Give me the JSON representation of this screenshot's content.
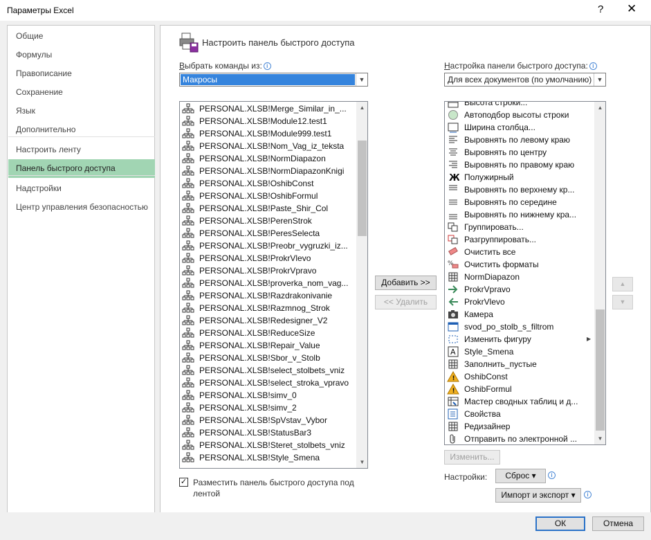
{
  "window": {
    "title": "Параметры Excel",
    "help": "?",
    "close": "✕"
  },
  "nav": {
    "items": [
      {
        "label": "Общие"
      },
      {
        "label": "Формулы"
      },
      {
        "label": "Правописание"
      },
      {
        "label": "Сохранение"
      },
      {
        "label": "Язык"
      },
      {
        "label": "Дополнительно"
      },
      {
        "label": "Настроить ленту"
      },
      {
        "label": "Панель быстрого доступа",
        "selected": true
      },
      {
        "label": "Надстройки"
      },
      {
        "label": "Центр управления безопасностью"
      }
    ]
  },
  "header": {
    "title": "Настроить панель быстрого доступа"
  },
  "left": {
    "label_underlined": "В",
    "label_rest": "ыбрать команды из:",
    "combo_value": "Макросы",
    "items": [
      "PERSONAL.XLSB!Merge_Similar_in_...",
      "PERSONAL.XLSB!Module12.test1",
      "PERSONAL.XLSB!Module999.test1",
      "PERSONAL.XLSB!Nom_Vag_iz_teksta",
      "PERSONAL.XLSB!NormDiapazon",
      "PERSONAL.XLSB!NormDiapazonKnigi",
      "PERSONAL.XLSB!OshibConst",
      "PERSONAL.XLSB!OshibFormul",
      "PERSONAL.XLSB!Paste_Shir_Col",
      "PERSONAL.XLSB!PerenStrok",
      "PERSONAL.XLSB!PeresSelecta",
      "PERSONAL.XLSB!Preobr_vygruzki_iz...",
      "PERSONAL.XLSB!ProkrVlevo",
      "PERSONAL.XLSB!ProkrVpravo",
      "PERSONAL.XLSB!proverka_nom_vag...",
      "PERSONAL.XLSB!Razdrakonivanie",
      "PERSONAL.XLSB!Razmnog_Strok",
      "PERSONAL.XLSB!Redesigner_V2",
      "PERSONAL.XLSB!ReduceSize",
      "PERSONAL.XLSB!Repair_Value",
      "PERSONAL.XLSB!Sbor_v_Stolb",
      "PERSONAL.XLSB!select_stolbets_vniz",
      "PERSONAL.XLSB!select_stroka_vpravo",
      "PERSONAL.XLSB!simv_0",
      "PERSONAL.XLSB!simv_2",
      "PERSONAL.XLSB!SpVstav_Vybor",
      "PERSONAL.XLSB!StatusBar3",
      "PERSONAL.XLSB!Steret_stolbets_vniz",
      "PERSONAL.XLSB!Style_Smena"
    ],
    "checkbox_line1": "Разместить панель быстрого доступа под",
    "checkbox_line2": "лентой"
  },
  "middle": {
    "add_button": "Добавить >>",
    "remove_button": "<< Удалить"
  },
  "right": {
    "label_underlined": "Н",
    "label_rest": "астройка панели быстрого доступа:",
    "combo_value": "Для всех документов (по умолчанию)",
    "items": [
      {
        "label": "Высота строки...",
        "icon": "row-height-icon"
      },
      {
        "label": "Автоподбор высоты строки",
        "icon": "autofit-icon"
      },
      {
        "label": "Ширина столбца...",
        "icon": "column-width-icon"
      },
      {
        "label": "Выровнять по левому краю",
        "icon": "align-left-icon"
      },
      {
        "label": "Выровнять по центру",
        "icon": "align-center-icon"
      },
      {
        "label": "Выровнять по правому краю",
        "icon": "align-right-icon"
      },
      {
        "label": "Полужирный",
        "icon": "bold-icon"
      },
      {
        "label": "Выровнять по верхнему кр...",
        "icon": "align-top-icon"
      },
      {
        "label": "Выровнять по середине",
        "icon": "align-middle-icon"
      },
      {
        "label": "Выровнять по нижнему кра...",
        "icon": "align-bottom-icon"
      },
      {
        "label": "Группировать...",
        "icon": "group-icon"
      },
      {
        "label": "Разгруппировать...",
        "icon": "ungroup-icon"
      },
      {
        "label": "Очистить все",
        "icon": "eraser-icon"
      },
      {
        "label": "Очистить форматы",
        "icon": "clear-formats-icon"
      },
      {
        "label": "NormDiapazon",
        "icon": "grid-icon"
      },
      {
        "label": "ProkrVpravo",
        "icon": "arrow-right-icon"
      },
      {
        "label": "ProkrVlevo",
        "icon": "arrow-left-icon"
      },
      {
        "label": "Камера",
        "icon": "camera-icon"
      },
      {
        "label": "svod_po_stolb_s_filtrom",
        "icon": "table-icon"
      },
      {
        "label": "Изменить фигуру",
        "icon": "edit-shape-icon"
      },
      {
        "label": "Style_Smena",
        "icon": "style-icon"
      },
      {
        "label": "Заполнить_пустые",
        "icon": "grid-icon"
      },
      {
        "label": "OshibConst",
        "icon": "warning-icon"
      },
      {
        "label": "OshibFormul",
        "icon": "warning-icon"
      },
      {
        "label": "Мастер сводных таблиц и д...",
        "icon": "pivot-icon"
      },
      {
        "label": "Свойства",
        "icon": "properties-icon"
      },
      {
        "label": "Редизайнер",
        "icon": "grid-icon"
      },
      {
        "label": "Отправить по электронной ...",
        "icon": "attachment-icon"
      }
    ],
    "modify_button": "Изменить...",
    "settings_label": "Настройки:",
    "reset_button": "Сброс",
    "import_export_button": "Импорт и экспорт"
  },
  "footer": {
    "ok": "ОК",
    "cancel": "Отмена"
  }
}
